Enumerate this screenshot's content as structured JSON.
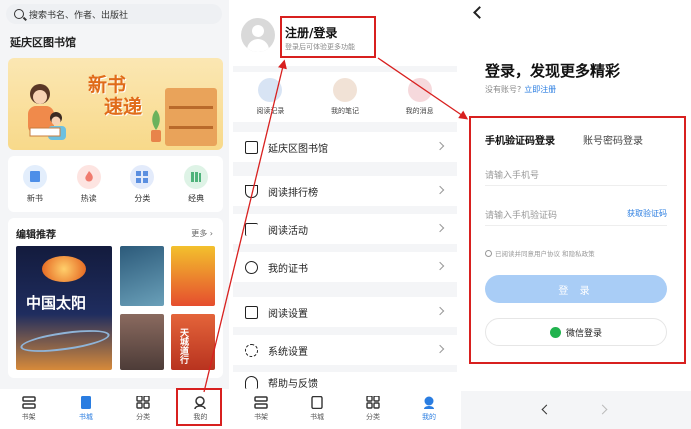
{
  "screen1": {
    "search_placeholder": "搜索书名、作者、出版社",
    "library_name": "延庆区图书馆",
    "banner_text_1": "新书",
    "banner_text_2": "速递",
    "categories": [
      {
        "label": "新书",
        "icon": "new-book-icon",
        "color": "#4e8fe8"
      },
      {
        "label": "热读",
        "icon": "fire-icon",
        "color": "#f07b6e"
      },
      {
        "label": "分类",
        "icon": "category-icon",
        "color": "#5b8fe0"
      },
      {
        "label": "经典",
        "icon": "classic-book-icon",
        "color": "#4fb37b"
      }
    ],
    "recommend_title": "编辑推荐",
    "recommend_more": "更多 ›",
    "book_main_title": "中国太阳",
    "book5_title": "天城道行",
    "tabs": [
      {
        "label": "书架",
        "icon": "bookshelf-icon"
      },
      {
        "label": "书城",
        "icon": "bookstore-icon"
      },
      {
        "label": "分类",
        "icon": "grid-icon"
      },
      {
        "label": "我的",
        "icon": "profile-icon"
      }
    ]
  },
  "screen2": {
    "login_title": "注册/登录",
    "login_subtitle": "登录后可体验更多功能",
    "quick_items": [
      {
        "label": "阅读记录",
        "color": "#d8e4f4"
      },
      {
        "label": "我的笔记",
        "color": "#f1e2d6"
      },
      {
        "label": "我的消息",
        "color": "#f6d9dc"
      }
    ],
    "menu_items": [
      {
        "label": "延庆区图书馆",
        "icon": "library-icon"
      },
      {
        "label": "阅读排行榜",
        "icon": "trophy-icon"
      },
      {
        "label": "阅读活动",
        "icon": "flag-icon"
      },
      {
        "label": "我的证书",
        "icon": "certificate-icon"
      },
      {
        "label": "阅读设置",
        "icon": "book-settings-icon"
      },
      {
        "label": "系统设置",
        "icon": "gear-icon"
      },
      {
        "label": "帮助与反馈",
        "icon": "headset-icon"
      }
    ],
    "tabs": [
      {
        "label": "书架",
        "icon": "bookshelf-icon"
      },
      {
        "label": "书城",
        "icon": "bookstore-icon"
      },
      {
        "label": "分类",
        "icon": "grid-icon"
      },
      {
        "label": "我的",
        "icon": "profile-icon"
      }
    ]
  },
  "screen3": {
    "title": "登录，发现更多精彩",
    "no_account": "没有账号?",
    "register_link": "立即注册",
    "tab_sms": "手机验证码登录",
    "tab_password": "账号密码登录",
    "phone_placeholder": "请输入手机号",
    "code_placeholder": "请输入手机验证码",
    "get_code": "获取验证码",
    "agreement": "已阅读并同意用户协议 和隐私政策",
    "login_button": "登 录",
    "wechat_button": "微信登录"
  },
  "colors": {
    "accent": "#2a7de1",
    "highlight": "#d8201f",
    "login_button": "#a9cdf6",
    "wechat": "#21b34e"
  }
}
